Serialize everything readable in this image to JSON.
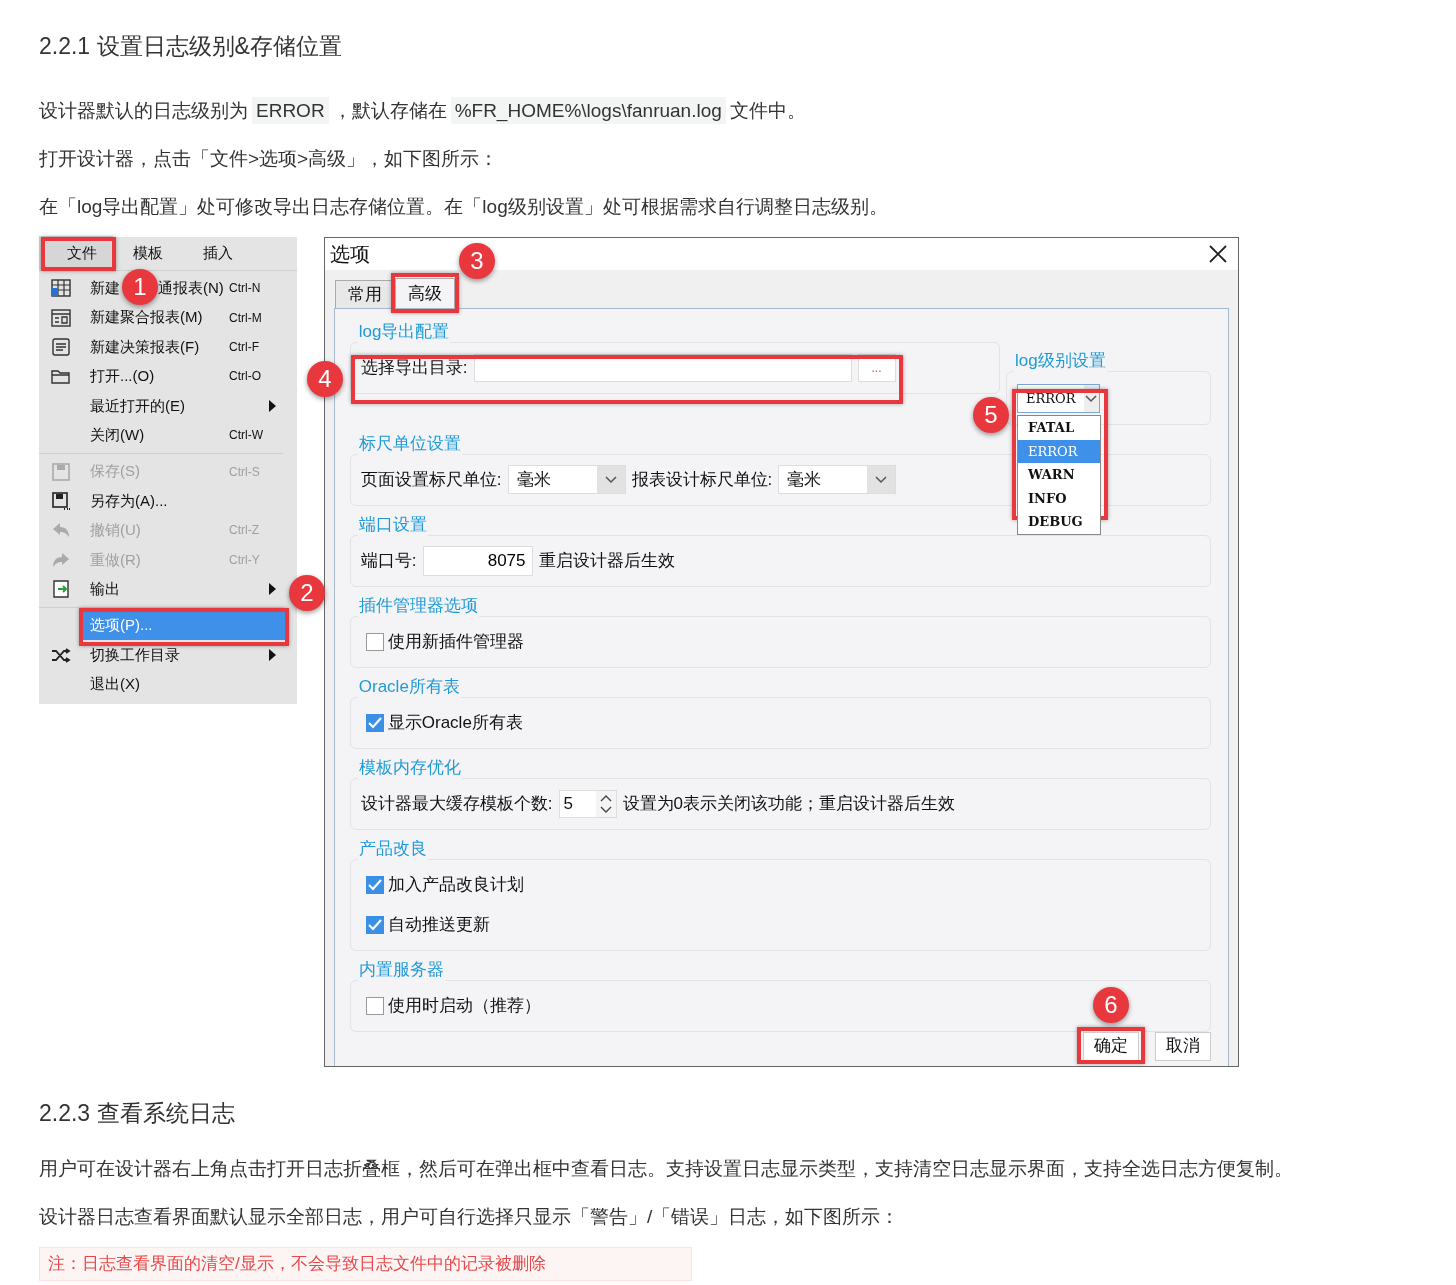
{
  "heading_1": "2.2.1 设置日志级别&存储位置",
  "paragraphs_1": [
    [
      {
        "kind": "text",
        "text": "设计器默认的日志级别为"
      },
      {
        "kind": "code",
        "text": "ERROR"
      },
      {
        "kind": "text",
        "text": "，默认存储在"
      },
      {
        "kind": "code",
        "text": "%FR_HOME%\\logs\\fanruan.log"
      },
      {
        "kind": "text",
        "text": "文件中。"
      }
    ],
    [
      {
        "kind": "text",
        "text": "打开设计器，点击「文件>选项>高级」，如下图所示："
      }
    ],
    [
      {
        "kind": "text",
        "text": "在「log导出配置」处可修改导出日志存储位置。在「log级别设置」处可根据需求自行调整日志级别。"
      }
    ]
  ],
  "menu": {
    "bar": [
      {
        "label": "文件",
        "selected": true
      },
      {
        "label": "模板",
        "selected": false
      },
      {
        "label": "插入",
        "selected": false
      }
    ],
    "items": [
      {
        "kind": "item",
        "label": "新建",
        "label_2": "通报表(N)",
        "shortcut": "Ctrl-N",
        "disabled": false,
        "submenu": false,
        "selected": false
      },
      {
        "kind": "item",
        "label": "新建聚合报表(M)",
        "shortcut": "Ctrl-M",
        "disabled": false,
        "submenu": false,
        "selected": false
      },
      {
        "kind": "item",
        "label": "新建决策报表(F)",
        "shortcut": "Ctrl-F",
        "disabled": false,
        "submenu": false,
        "selected": false
      },
      {
        "kind": "item",
        "label": "打开...(O)",
        "shortcut": "Ctrl-O",
        "disabled": false,
        "submenu": false,
        "selected": false
      },
      {
        "kind": "item",
        "label": "最近打开的(E)",
        "disabled": false,
        "submenu": true,
        "selected": false
      },
      {
        "kind": "item",
        "label": "关闭(W)",
        "shortcut": "Ctrl-W",
        "disabled": false,
        "submenu": false,
        "selected": false
      },
      {
        "kind": "separator"
      },
      {
        "kind": "item",
        "label": "保存(S)",
        "shortcut": "Ctrl-S",
        "disabled": true,
        "submenu": false,
        "selected": false
      },
      {
        "kind": "item",
        "label": "另存为(A)...",
        "disabled": false,
        "submenu": false,
        "selected": false
      },
      {
        "kind": "item",
        "label": "撤销(U)",
        "shortcut": "Ctrl-Z",
        "disabled": true,
        "submenu": false,
        "selected": false
      },
      {
        "kind": "item",
        "label": "重做(R)",
        "shortcut": "Ctrl-Y",
        "disabled": true,
        "submenu": false,
        "selected": false
      },
      {
        "kind": "item",
        "label": "输出",
        "disabled": false,
        "submenu": true,
        "selected": false
      },
      {
        "kind": "separator"
      },
      {
        "kind": "item",
        "label": "选项(P)...",
        "disabled": false,
        "submenu": false,
        "selected": true
      },
      {
        "kind": "item",
        "label": "切换工作目录",
        "disabled": false,
        "submenu": true,
        "selected": false
      },
      {
        "kind": "item",
        "label": "退出(X)",
        "disabled": false,
        "submenu": false,
        "selected": false
      }
    ]
  },
  "dialog": {
    "title": "选项",
    "tabs": [
      {
        "label": "常用",
        "selected": false
      },
      {
        "label": "高级",
        "selected": true
      }
    ],
    "groups": [
      {
        "legend": "log导出配置",
        "rows": [
          [
            {
              "kind": "label",
              "text": "选择导出目录:"
            },
            {
              "kind": "path_field"
            },
            {
              "kind": "browse",
              "text": "..."
            }
          ]
        ]
      },
      {
        "legend": "log级别设置",
        "rows": [
          [
            {
              "kind": "select",
              "value": "ERROR",
              "expanded": true,
              "options": [
                {
                  "label": "FATAL",
                  "selected": false
                },
                {
                  "label": "ERROR",
                  "selected": true
                },
                {
                  "label": "WARN",
                  "selected": false
                },
                {
                  "label": "INFO",
                  "selected": false
                },
                {
                  "label": "DEBUG",
                  "selected": false
                }
              ]
            }
          ]
        ]
      },
      {
        "legend": "标尺单位设置",
        "rows": [
          [
            {
              "kind": "label",
              "text": "页面设置标尺单位:"
            },
            {
              "kind": "select",
              "value": "毫米"
            },
            {
              "kind": "label",
              "text": "报表设计标尺单位:"
            },
            {
              "kind": "select",
              "value": "毫米"
            }
          ]
        ]
      },
      {
        "legend": "端口设置",
        "rows": [
          [
            {
              "kind": "label",
              "text": "端口号:"
            },
            {
              "kind": "number_field",
              "value": "8075"
            },
            {
              "kind": "label",
              "text": "重启设计器后生效"
            }
          ]
        ]
      },
      {
        "legend": "插件管理器选项",
        "rows": [
          [
            {
              "kind": "checkbox",
              "label": "使用新插件管理器",
              "checked": false
            }
          ]
        ]
      },
      {
        "legend": "Oracle所有表",
        "rows": [
          [
            {
              "kind": "checkbox",
              "label": "显示Oracle所有表",
              "checked": true
            }
          ]
        ]
      },
      {
        "legend": "模板内存优化",
        "rows": [
          [
            {
              "kind": "label",
              "text": "设计器最大缓存模板个数:"
            },
            {
              "kind": "spinner",
              "value": "5"
            },
            {
              "kind": "label",
              "text": "设置为0表示关闭该功能；重启设计器后生效"
            }
          ]
        ]
      },
      {
        "legend": "产品改良",
        "rows": [
          [
            {
              "kind": "checkbox",
              "label": "加入产品改良计划",
              "checked": true
            }
          ],
          [
            {
              "kind": "checkbox",
              "label": "自动推送更新",
              "checked": true
            }
          ]
        ]
      },
      {
        "legend": "内置服务器",
        "rows": [
          [
            {
              "kind": "checkbox",
              "label": "使用时启动（推荐）",
              "checked": false
            }
          ]
        ]
      }
    ],
    "buttons": [
      "确定",
      "取消"
    ]
  },
  "callouts": [
    "1",
    "2",
    "3",
    "4",
    "5",
    "6"
  ],
  "heading_2": "2.2.3 查看系统日志",
  "paragraphs_2": [
    "用户可在设计器右上角点击打开日志折叠框，然后可在弹出框中查看日志。支持设置日志显示类型，支持清空日志显示界面，支持全选日志方便复制。",
    "设计器日志查看界面默认显示全部日志，用户可自行选择只显示「警告」/「错误」日志，如下图所示："
  ],
  "note": "注：日志查看界面的清空/显示，不会导致日志文件中的记录被删除"
}
